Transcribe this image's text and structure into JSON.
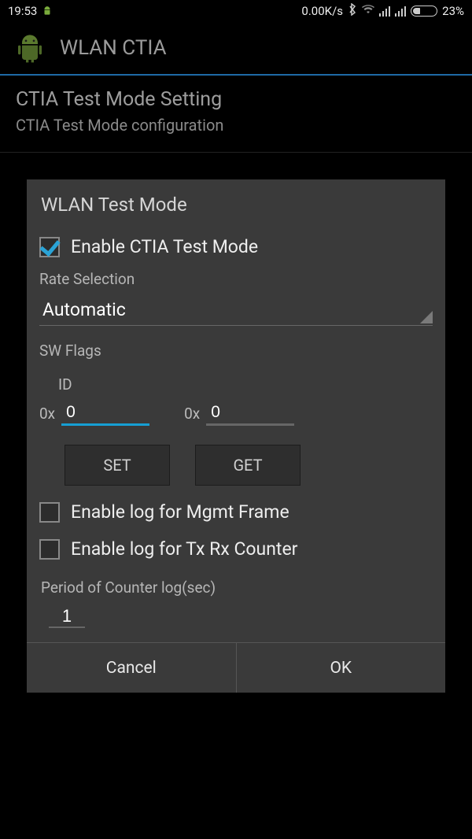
{
  "status": {
    "time": "19:53",
    "net_speed": "0.00K/s",
    "battery_pct": "23%"
  },
  "app": {
    "title": "WLAN CTIA"
  },
  "header": {
    "title": "CTIA Test Mode Setting",
    "subtitle": "CTIA Test Mode configuration"
  },
  "dialog": {
    "title": "WLAN Test Mode",
    "enable_ctia_label": "Enable CTIA Test Mode",
    "rate_selection_label": "Rate Selection",
    "rate_selection_value": "Automatic",
    "sw_flags_label": "SW Flags",
    "id_label": "ID",
    "hex_prefix": "0x",
    "hex1_value": "0",
    "hex2_value": "0",
    "set_btn": "SET",
    "get_btn": "GET",
    "log_mgmt_label": "Enable log for Mgmt Frame",
    "log_txrx_label": "Enable log for Tx Rx Counter",
    "period_label": "Period of Counter log(sec)",
    "period_value": "1",
    "cancel_btn": "Cancel",
    "ok_btn": "OK"
  }
}
